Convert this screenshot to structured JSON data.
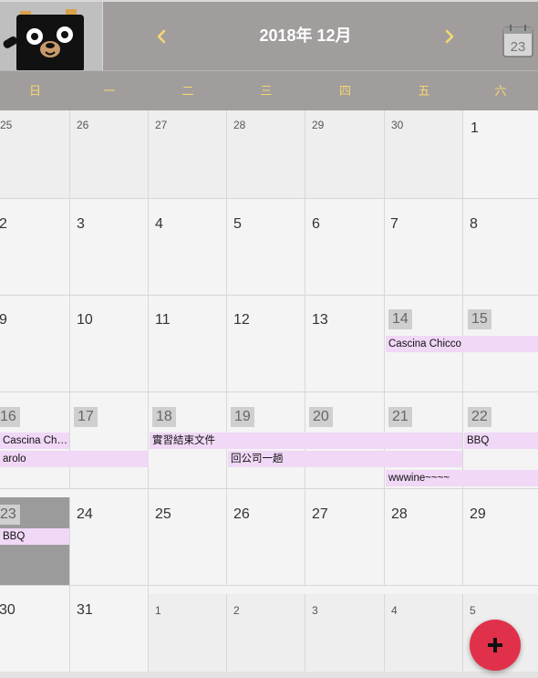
{
  "header": {
    "title": "2018年 12月",
    "prev_label": "‹",
    "next_label": "›",
    "today_number": "23",
    "logo": "bear-mascot",
    "accent_color": "#f5d76e",
    "header_color": "#a19d9d"
  },
  "weekdays": [
    "日",
    "一",
    "二",
    "三",
    "四",
    "五",
    "六"
  ],
  "weeks": [
    [
      "25",
      "26",
      "27",
      "28",
      "29",
      "30",
      "1"
    ],
    [
      "2",
      "3",
      "4",
      "5",
      "6",
      "7",
      "8"
    ],
    [
      "9",
      "10",
      "11",
      "12",
      "13",
      "14",
      "15"
    ],
    [
      "16",
      "17",
      "18",
      "19",
      "20",
      "21",
      "22"
    ],
    [
      "23",
      "24",
      "25",
      "26",
      "27",
      "28",
      "29"
    ],
    [
      "30",
      "31",
      "1",
      "2",
      "3",
      "4",
      "5"
    ]
  ],
  "events": {
    "cascina_1": "Cascina Chicco",
    "cascina_2": "Cascina Chic...",
    "shixi": "實習結束文件",
    "bbq_1": "BBQ",
    "barolo": "arolo",
    "huigongsi": "回公司一趟",
    "wwwine": "wwwine~~~~",
    "bbq_2": "BBQ"
  },
  "fab": {
    "icon": "plus-icon",
    "color": "#e1304a"
  }
}
